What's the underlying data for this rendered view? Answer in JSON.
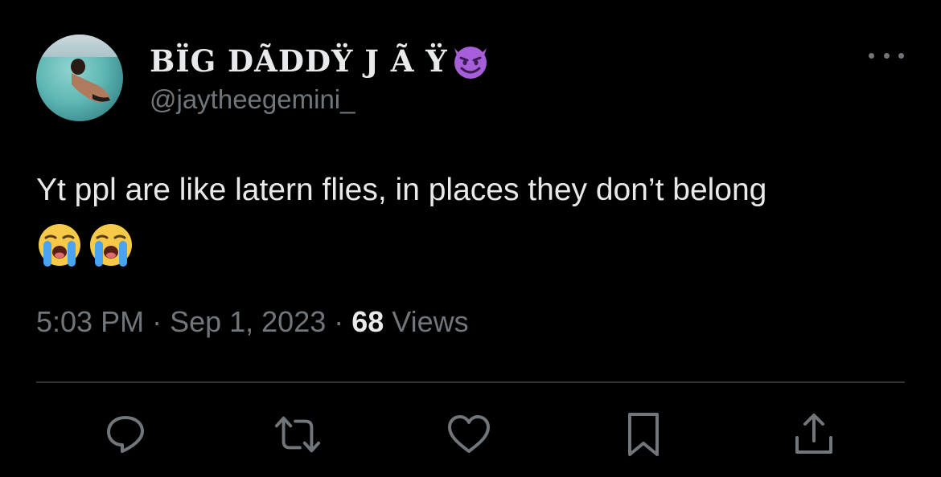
{
  "tweet": {
    "display_name": "BÏG DÃDDŸ J Ã Ÿ",
    "display_name_emoji": "smiling-devil-icon",
    "handle": "@jaytheegemini_",
    "text": "Yt ppl are like latern flies, in places they don’t belong",
    "text_emojis": [
      "loudly-crying-face-icon",
      "loudly-crying-face-icon"
    ],
    "time": "5:03 PM",
    "separator_1": " · ",
    "date": "Sep 1, 2023",
    "separator_2": " · ",
    "views_count": "68",
    "views_label": " Views"
  },
  "actions": [
    {
      "name": "reply-icon"
    },
    {
      "name": "retweet-icon"
    },
    {
      "name": "like-icon"
    },
    {
      "name": "bookmark-icon"
    },
    {
      "name": "share-icon"
    }
  ],
  "colors": {
    "background": "#000000",
    "primary_text": "#e7e9ea",
    "secondary_text": "#71767b",
    "divider": "#2f3336",
    "devil_purple": "#a65fd8"
  }
}
